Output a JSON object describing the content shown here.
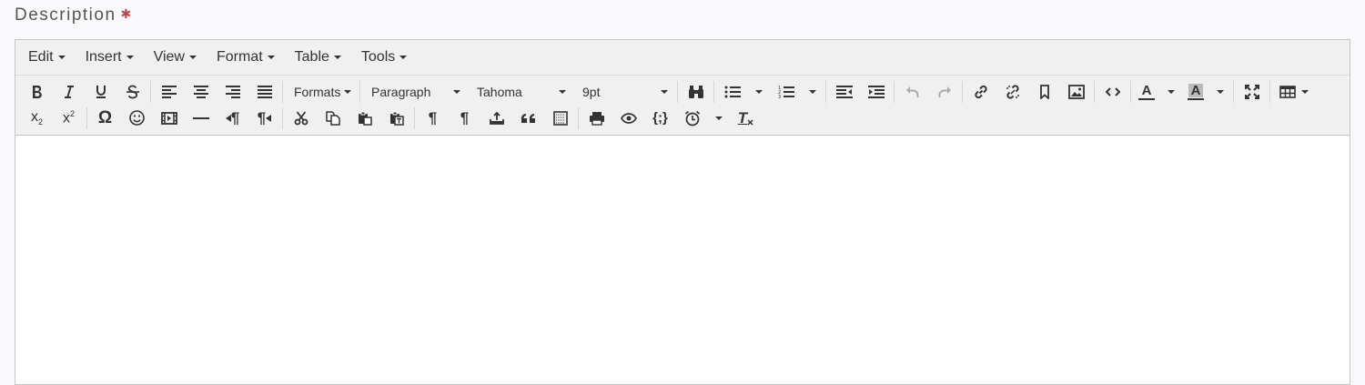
{
  "field": {
    "label": "Description",
    "required_mark": "✱"
  },
  "menubar": {
    "items": [
      "Edit",
      "Insert",
      "View",
      "Format",
      "Table",
      "Tools"
    ]
  },
  "toolbar": {
    "formats_label": "Formats",
    "block_format": "Paragraph",
    "font_family": "Tahoma",
    "font_size": "9pt",
    "text_color_letter": "A",
    "bg_color_letter": "A",
    "omega": "Ω",
    "subscript_base": "x",
    "subscript_index": "2",
    "superscript_base": "x",
    "superscript_index": "2",
    "pilcrow": "¶",
    "quote_glyph": "❝❝",
    "template_glyph": "{;}",
    "clear_format": "T"
  },
  "colors": {
    "required": "#b94a48",
    "toolbar_bg": "#f0f0f0",
    "border": "#c5c5c5"
  }
}
